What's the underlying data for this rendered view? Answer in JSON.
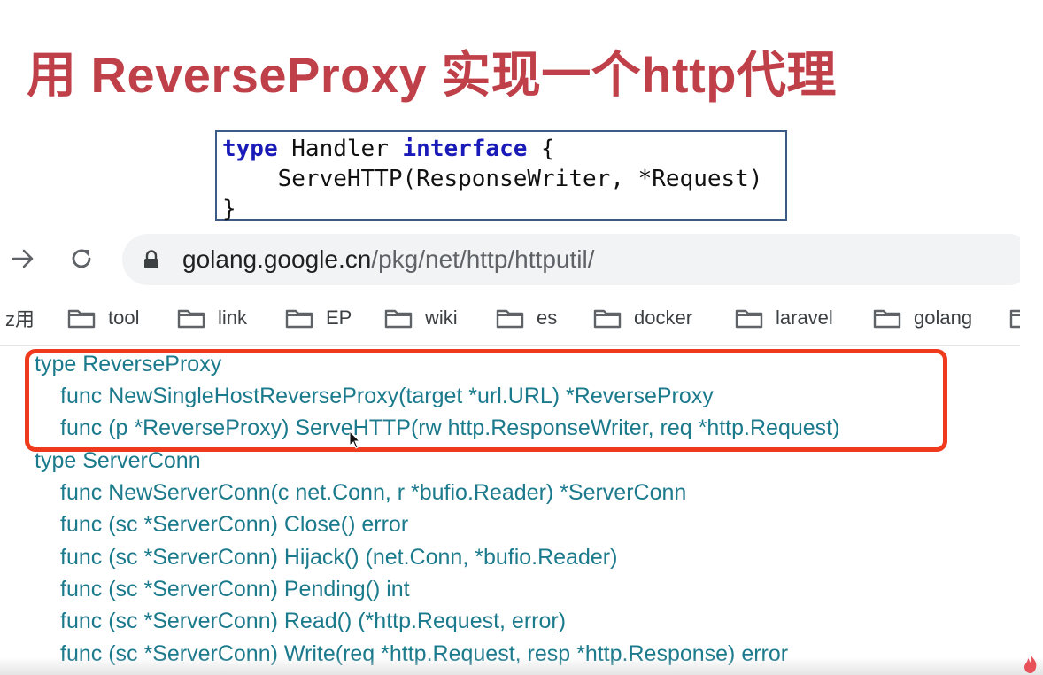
{
  "slide": {
    "title": "用 ReverseProxy 实现一个http代理",
    "code": {
      "kw_type": "type",
      "handler": " Handler ",
      "kw_interface": "interface",
      "open_brace": " {",
      "line2": "    ServeHTTP(ResponseWriter, *Request)",
      "line3": "}"
    }
  },
  "browser": {
    "url_host": "golang.google.cn",
    "url_path": "/pkg/net/http/httputil/",
    "bookmarks": {
      "apps_partial": "z用",
      "items": [
        "tool",
        "link",
        "EP",
        "wiki",
        "es",
        "docker",
        "laravel",
        "golang"
      ]
    }
  },
  "doc_index": {
    "lines": [
      "type ReverseProxy",
      "func NewSingleHostReverseProxy(target *url.URL) *ReverseProxy",
      "func (p *ReverseProxy) ServeHTTP(rw http.ResponseWriter, req *http.Request)",
      "type ServerConn",
      "func NewServerConn(c net.Conn, r *bufio.Reader) *ServerConn",
      "func (sc *ServerConn) Close() error",
      "func (sc *ServerConn) Hijack() (net.Conn, *bufio.Reader)",
      "func (sc *ServerConn) Pending() int",
      "func (sc *ServerConn) Read() (*http.Request, error)",
      "func (sc *ServerConn) Write(req *http.Request, resp *http.Response) error"
    ]
  },
  "colors": {
    "title": "#c0404a",
    "doc_link": "#1b7a8c",
    "highlight": "#f03a1e",
    "keyword": "#1a1ab8"
  }
}
